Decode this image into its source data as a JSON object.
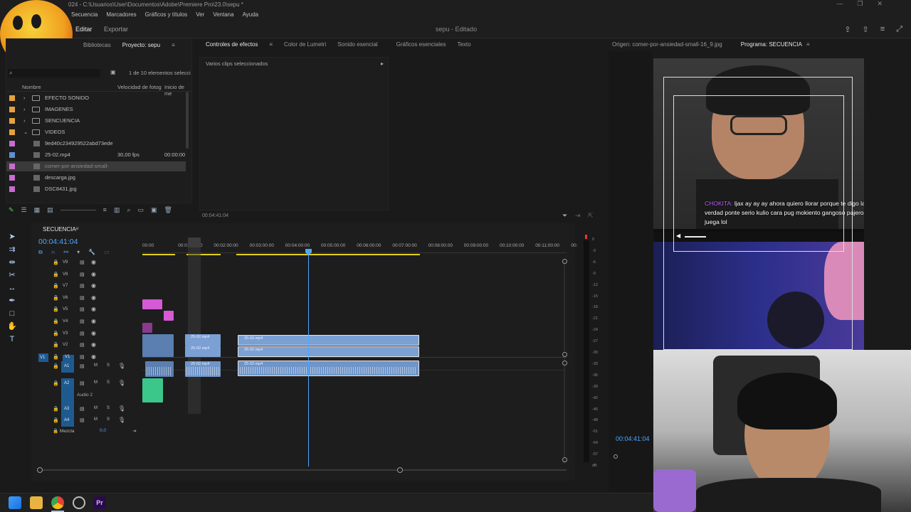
{
  "window": {
    "title": "024 - C:\\Usuarios\\User\\Documentos\\Adobe\\Premiere Pro\\23.0\\sepu *"
  },
  "menu": [
    "Secuencia",
    "Marcadores",
    "Gráficos y títulos",
    "Ver",
    "Ventana",
    "Ayuda"
  ],
  "header": {
    "edit_tab": "Editar",
    "export_tab": "Exportar",
    "doc_title": "sepu",
    "doc_state": "- Editado"
  },
  "project": {
    "tabs": [
      "Bibliotecas",
      "Proyecto: sepu"
    ],
    "count": "1 de 10 elementos selecci",
    "col_name": "Nombre",
    "col_fps": "Velocidad de fotog",
    "col_start": "Inicio de me",
    "items": [
      {
        "name": "EFECTO SONIDO",
        "color": "#e6a23c",
        "type": "folder",
        "fps": "",
        "start": ""
      },
      {
        "name": "IMAGENES",
        "color": "#e6a23c",
        "type": "folder",
        "fps": "",
        "start": ""
      },
      {
        "name": "SENCUENCIA",
        "color": "#e6a23c",
        "type": "folder",
        "fps": "",
        "start": ""
      },
      {
        "name": "VIDEOS",
        "color": "#e6a23c",
        "type": "folder",
        "fps": "",
        "start": ""
      },
      {
        "name": "9ed40c234929522abd73ede",
        "color": "#c86ccf",
        "type": "file",
        "fps": "",
        "start": ""
      },
      {
        "name": "25-02.mp4",
        "color": "#5f8fd0",
        "type": "file",
        "fps": "30,00 fps",
        "start": "00:00:00"
      },
      {
        "name": "comer-por-ansiedad-small-",
        "color": "#c86ccf",
        "type": "file",
        "fps": "",
        "start": ""
      },
      {
        "name": "descarga.jpg",
        "color": "#c86ccf",
        "type": "file",
        "fps": "",
        "start": ""
      },
      {
        "name": "DSC8431.jpg",
        "color": "#c86ccf",
        "type": "file",
        "fps": "",
        "start": ""
      }
    ]
  },
  "effects": {
    "tabs": [
      "Controles de efectos",
      "Color de Lumetri",
      "Sonido esencial",
      "Gráficos esenciales",
      "Texto"
    ],
    "subtitle": "Varios clips seleccionados",
    "time": "00:04:41:04"
  },
  "program": {
    "source_tab": "Origen: comer-por-ansiedad-small-16_9.jpg",
    "program_tab": "Programa: SECUENCIA",
    "timecode": "00:04:41:04",
    "chat_user": "CHOKITA:",
    "chat_text": "ljax ay ay ay ahora quiero llorar porque te digo la verdad ponte serio kulio cara pug mokiento gangoso pajero juega lol"
  },
  "timeline": {
    "seq_name": "SECUENCIA",
    "timecode": "00:04:41:04",
    "ruler": [
      "00:00",
      "00:01:00:00",
      "00:02:00:00",
      "00:03:00:00",
      "00:04:00:00",
      "00:05:00:00",
      "00:06:00:00",
      "00:07:00:00",
      "00:08:00:00",
      "00:09:00:00",
      "00:10:00:00",
      "00:11:00:00",
      "00:"
    ],
    "video_tracks": [
      "V9",
      "V8",
      "V7",
      "V6",
      "V5",
      "V4",
      "V3",
      "V2",
      "V1"
    ],
    "audio_tracks": [
      "A1",
      "A2",
      "A3",
      "A4"
    ],
    "audio2_label": "Audio 2",
    "mix_label": "Mezcla",
    "mix_value": "0,0",
    "clip_label": "25-02.mp4",
    "v1_src": "V1",
    "mute": "M",
    "solo": "S"
  },
  "meter": {
    "ticks": [
      "0",
      "-3",
      "-6",
      "-9",
      "-12",
      "-15",
      "-18",
      "-21",
      "-24",
      "-27",
      "-30",
      "-33",
      "-36",
      "-39",
      "-42",
      "-45",
      "-48",
      "-51",
      "-54",
      "-57",
      "dB"
    ]
  },
  "colors": {
    "accent": "#2d8ceb",
    "clip_blue": "#7ba0d4",
    "clip_pink": "#d55ad6",
    "clip_green": "#3cc78a",
    "yellow_bar": "#e0d01c"
  }
}
